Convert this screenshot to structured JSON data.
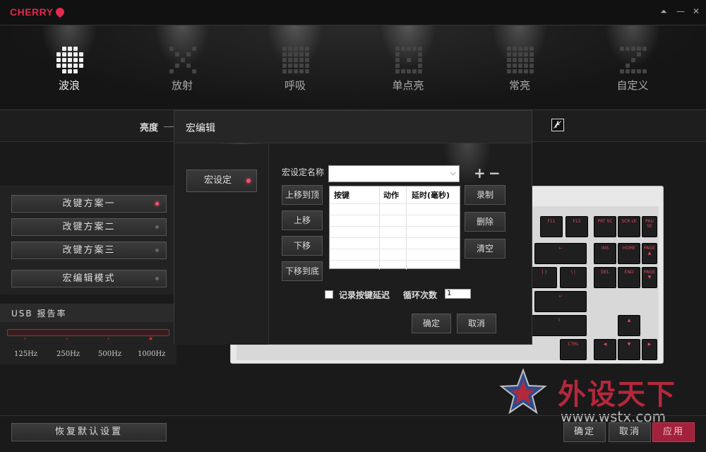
{
  "app": {
    "logo_text": "CHERRY"
  },
  "window_controls": {
    "pin": "⏶",
    "minimize": "—",
    "close": "✕"
  },
  "modes": [
    {
      "label": "波浪",
      "active": true
    },
    {
      "label": "放射",
      "active": false
    },
    {
      "label": "呼吸",
      "active": false
    },
    {
      "label": "单点亮",
      "active": false
    },
    {
      "label": "常亮",
      "active": false
    },
    {
      "label": "自定义",
      "active": false
    }
  ],
  "brightness": {
    "label": "亮度"
  },
  "profiles": [
    {
      "label": "改键方案一",
      "active": true
    },
    {
      "label": "改键方案二",
      "active": false
    },
    {
      "label": "改键方案三",
      "active": false
    }
  ],
  "macro_mode": {
    "label": "宏编辑模式"
  },
  "usb": {
    "title": "USB 报告率",
    "rates": [
      "125Hz",
      "250Hz",
      "500Hz",
      "1000Hz"
    ],
    "selected": "1000Hz"
  },
  "reset": {
    "label": "恢复默认设置"
  },
  "footer": {
    "ok": "确定",
    "cancel": "取消",
    "apply": "应用"
  },
  "watermark": {
    "cn": "外设天下",
    "url": "www.wstx.com"
  },
  "dialog": {
    "title": "宏编辑",
    "side_button": "宏设定",
    "name_label": "宏设定名称",
    "name_value": "",
    "add": "+",
    "remove": "−",
    "move_top": "上移到顶",
    "move_up": "上移",
    "move_down": "下移",
    "move_bottom": "下移到底",
    "record": "录制",
    "delete": "删除",
    "clear": "清空",
    "table_headers": [
      "按键",
      "动作",
      "延时(毫秒)"
    ],
    "record_delay_label": "记录按键延迟",
    "loop_label": "循环次数",
    "loop_value": "1",
    "ok": "确定",
    "cancel": "取消"
  },
  "keys": [
    {
      "label": "F11"
    },
    {
      "label": "F12"
    },
    {
      "label": "PRT SC"
    },
    {
      "label": "SCR LK"
    },
    {
      "label": "PAU SE"
    },
    {
      "label": "INS"
    },
    {
      "label": "HOME"
    },
    {
      "label": "PAGE ▲"
    },
    {
      "label": "DEL"
    },
    {
      "label": "END"
    },
    {
      "label": "PAGE ▼"
    },
    {
      "label": "CTRL"
    }
  ]
}
